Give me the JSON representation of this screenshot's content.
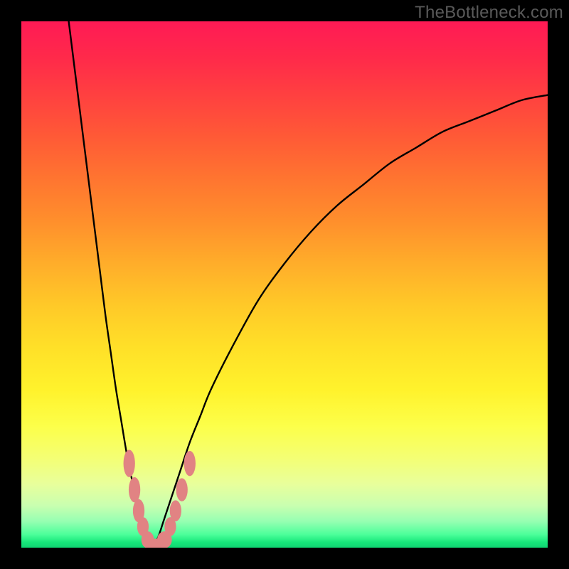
{
  "watermark": "TheBottleneck.com",
  "colors": {
    "frame": "#000000",
    "curve": "#000000",
    "marker_fill": "#e18383",
    "marker_stroke": "#d06a6a",
    "gradient_top": "#ff1a55",
    "gradient_bottom": "#10d472"
  },
  "chart_data": {
    "type": "line",
    "title": "",
    "xlabel": "",
    "ylabel": "",
    "xlim": [
      0,
      100
    ],
    "ylim": [
      0,
      100
    ],
    "grid": false,
    "legend": false,
    "annotations": [
      "TheBottleneck.com"
    ],
    "series": [
      {
        "name": "left-branch",
        "x": [
          9,
          10,
          11,
          12,
          13,
          14,
          15,
          16,
          17,
          18,
          19,
          20,
          21,
          22,
          23,
          24,
          25
        ],
        "y": [
          100,
          92,
          84,
          76,
          68,
          60,
          52,
          44,
          37,
          30,
          24,
          18,
          13,
          9,
          5,
          2,
          0
        ]
      },
      {
        "name": "right-branch",
        "x": [
          25,
          26,
          27,
          28,
          30,
          32,
          34,
          36,
          40,
          45,
          50,
          55,
          60,
          65,
          70,
          75,
          80,
          85,
          90,
          95,
          100
        ],
        "y": [
          0,
          2,
          5,
          8,
          14,
          20,
          25,
          30,
          38,
          47,
          54,
          60,
          65,
          69,
          73,
          76,
          79,
          81,
          83,
          85,
          86
        ]
      }
    ],
    "markers": [
      {
        "x": 20.5,
        "y": 16,
        "rx": 1.1,
        "ry": 2.6
      },
      {
        "x": 21.5,
        "y": 11,
        "rx": 1.1,
        "ry": 2.4
      },
      {
        "x": 22.3,
        "y": 7,
        "rx": 1.1,
        "ry": 2.2
      },
      {
        "x": 23.1,
        "y": 4,
        "rx": 1.1,
        "ry": 1.8
      },
      {
        "x": 24.0,
        "y": 1.5,
        "rx": 1.2,
        "ry": 1.6
      },
      {
        "x": 25.5,
        "y": 0.5,
        "rx": 1.8,
        "ry": 1.2
      },
      {
        "x": 27.2,
        "y": 1.5,
        "rx": 1.4,
        "ry": 1.6
      },
      {
        "x": 28.3,
        "y": 4,
        "rx": 1.1,
        "ry": 1.8
      },
      {
        "x": 29.3,
        "y": 7,
        "rx": 1.1,
        "ry": 2.0
      },
      {
        "x": 30.5,
        "y": 11,
        "rx": 1.1,
        "ry": 2.2
      },
      {
        "x": 32.0,
        "y": 16,
        "rx": 1.1,
        "ry": 2.4
      }
    ],
    "vertex_x": 25
  }
}
